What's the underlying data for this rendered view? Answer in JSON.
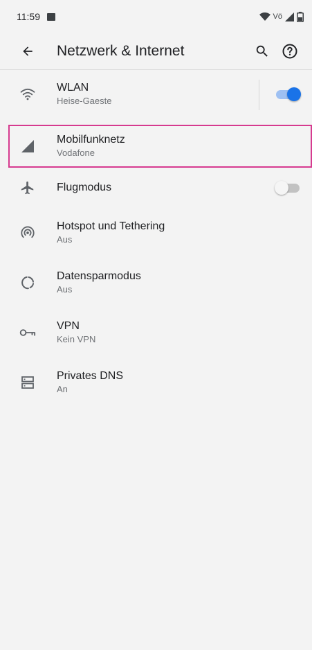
{
  "status_bar": {
    "time": "11:59",
    "net_label": "Vö"
  },
  "app_bar": {
    "title": "Netzwerk & Internet"
  },
  "items": [
    {
      "name": "wlan",
      "icon": "wifi-icon",
      "label": "WLAN",
      "subtitle": "Heise-Gaeste",
      "toggle": "on"
    },
    {
      "name": "mobilfunknetz",
      "icon": "cell-signal-icon",
      "label": "Mobilfunknetz",
      "subtitle": "Vodafone"
    },
    {
      "name": "flugmodus",
      "icon": "airplane-icon",
      "label": "Flugmodus",
      "toggle": "off"
    },
    {
      "name": "hotspot",
      "icon": "hotspot-icon",
      "label": "Hotspot und Tethering",
      "subtitle": "Aus"
    },
    {
      "name": "datensparmodus",
      "icon": "data-saver-icon",
      "label": "Datensparmodus",
      "subtitle": "Aus"
    },
    {
      "name": "vpn",
      "icon": "vpn-key-icon",
      "label": "VPN",
      "subtitle": "Kein VPN"
    },
    {
      "name": "privates-dns",
      "icon": "dns-icon",
      "label": "Privates DNS",
      "subtitle": "An"
    }
  ],
  "colors": {
    "accent": "#1a73e8",
    "selection_outline": "#d63a8f",
    "background": "#f3f3f3"
  }
}
